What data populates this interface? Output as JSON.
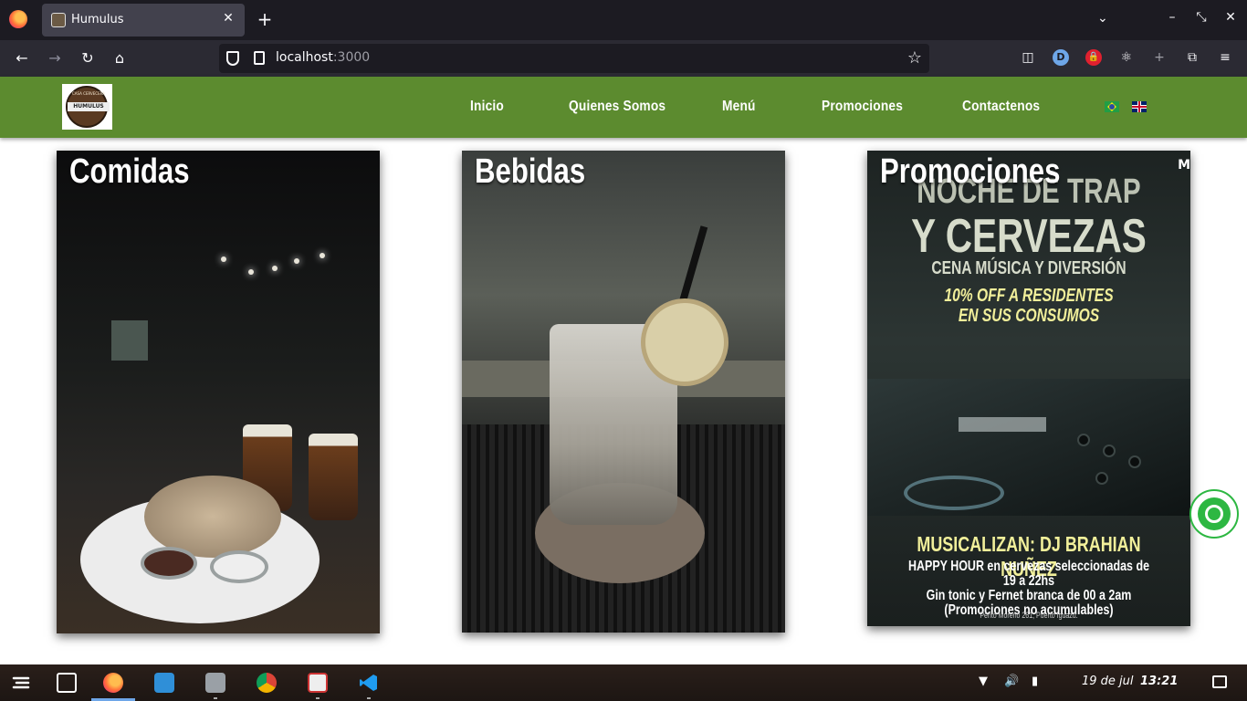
{
  "browser": {
    "tab": {
      "title": "Humulus",
      "close": "✕"
    },
    "new_tab": "+",
    "tab_list": "⌄",
    "window": {
      "minimize": "–",
      "restore": "⤡",
      "close": "✕"
    },
    "nav": {
      "back": "←",
      "forward": "→",
      "reload": "↻",
      "home": "⌂"
    },
    "url": {
      "host": "localhost",
      "port": ":3000"
    },
    "bookmark": "☆",
    "extensions": {
      "pocket": "◫",
      "profile": "D",
      "lock": "🔒",
      "react": "⚛",
      "plus": "+",
      "puzzle": "⧉",
      "menu": "≡"
    }
  },
  "site": {
    "logo_text": "HUMULUS",
    "logo_top": "CASA CERVECERA",
    "menu": [
      "Inicio",
      "Quienes Somos",
      "Menú",
      "Promociones",
      "Contactenos"
    ],
    "languages": [
      "pt-BR",
      "en-GB"
    ]
  },
  "cards": [
    {
      "title": "Comidas"
    },
    {
      "title": "Bebidas"
    },
    {
      "title": "Promociones",
      "poster": {
        "line1": "NOCHE DE TRAP",
        "line2": "Y CERVEZAS",
        "line3": "CENA MÚSICA Y DIVERSIÓN",
        "line4": "10% OFF A RESIDENTES",
        "line5": "EN SUS CONSUMOS",
        "dj": "MUSICALIZAN: DJ BRAHIAN NUÑEZ",
        "happy1": "HAPPY HOUR en cervezas seleccionadas de 19 a 22hs",
        "happy2": "Gin tonic y Fernet branca de 00 a 2am",
        "happy3": "(Promociones no acumulables)",
        "address": "Perito Moreno 261, Puerto Iguazú.",
        "corner": "M"
      }
    }
  ],
  "taskbar": {
    "date": "19 de jul",
    "time": "13:21"
  }
}
